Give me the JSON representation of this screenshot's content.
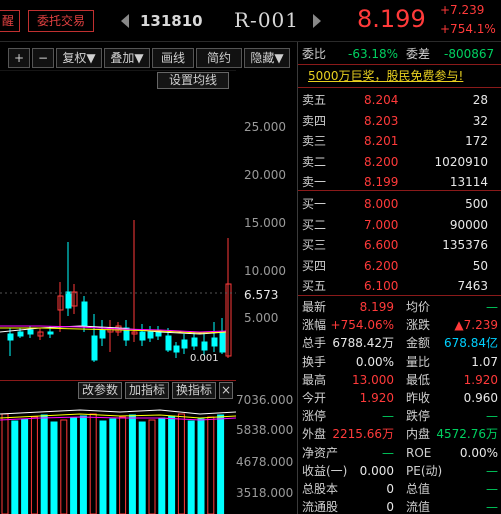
{
  "topbar": {
    "partial_tab": "醒",
    "trade_button": "委托交易",
    "code": "131810",
    "name": "R-001",
    "price": "8.199",
    "change": "+7.239",
    "change_pct": "+754.1%"
  },
  "toolbar": {
    "plus": "+",
    "minus": "−",
    "restore_rights": "复权▼",
    "overlay": "叠加▼",
    "draw_line": "画线",
    "brief": "简约",
    "hide": "隐藏▼"
  },
  "chart": {
    "ma_settings": "设置均线",
    "y_ticks": [
      "25.000",
      "20.000",
      "15.000",
      "10.000",
      "6.573",
      "5.000"
    ],
    "low_marker": "0.001",
    "indicator_buttons": {
      "change_params": "改参数",
      "add_indicator": "加指标",
      "switch_indicator": "换指标",
      "close": "×"
    },
    "vol_ticks": [
      "7036.000",
      "5838.000",
      "4678.000",
      "3518.000"
    ],
    "colors": {
      "up": "#ff3a3a",
      "down": "#00ffff",
      "ma5": "#ffffff",
      "ma10": "#ffff00",
      "ma20": "#ff00ff"
    }
  },
  "panel": {
    "weibi_label": "委比",
    "weibi": "-63.18%",
    "weicha_label": "委差",
    "weicha": "-800867",
    "ad": "5000万巨奖，股民免费参与!",
    "asks": [
      {
        "label": "卖五",
        "price": "8.204",
        "vol": "28"
      },
      {
        "label": "卖四",
        "price": "8.203",
        "vol": "32"
      },
      {
        "label": "卖三",
        "price": "8.201",
        "vol": "172"
      },
      {
        "label": "卖二",
        "price": "8.200",
        "vol": "1020910"
      },
      {
        "label": "卖一",
        "price": "8.199",
        "vol": "13114"
      }
    ],
    "bids": [
      {
        "label": "买一",
        "price": "8.000",
        "vol": "500"
      },
      {
        "label": "买二",
        "price": "7.000",
        "vol": "90000"
      },
      {
        "label": "买三",
        "price": "6.600",
        "vol": "135376"
      },
      {
        "label": "买四",
        "price": "6.200",
        "vol": "50"
      },
      {
        "label": "买五",
        "price": "6.100",
        "vol": "7463"
      }
    ],
    "stats": [
      {
        "l1": "最新",
        "v1": "8.199",
        "c1": "red",
        "l2": "均价",
        "v2": "—",
        "c2": "green"
      },
      {
        "l1": "涨幅",
        "v1": "+754.06%",
        "c1": "red",
        "l2": "涨跌",
        "v2": "▲7.239",
        "c2": "red"
      },
      {
        "l1": "总手",
        "v1": "6788.42万",
        "c1": "white",
        "l2": "金额",
        "v2": "678.84亿",
        "c2": "cyan"
      },
      {
        "l1": "换手",
        "v1": "0.00%",
        "c1": "white",
        "l2": "量比",
        "v2": "1.07",
        "c2": "white"
      },
      {
        "l1": "最高",
        "v1": "13.000",
        "c1": "red",
        "l2": "最低",
        "v2": "1.920",
        "c2": "red"
      },
      {
        "l1": "今开",
        "v1": "1.920",
        "c1": "red",
        "l2": "昨收",
        "v2": "0.960",
        "c2": "white"
      },
      {
        "l1": "涨停",
        "v1": "—",
        "c1": "green",
        "l2": "跌停",
        "v2": "—",
        "c2": "green"
      },
      {
        "l1": "外盘",
        "v1": "2215.66万",
        "c1": "red",
        "l2": "内盘",
        "v2": "4572.76万",
        "c2": "green"
      },
      {
        "l1": "净资产",
        "v1": "—",
        "c1": "green",
        "l2": "ROE",
        "v2": "0.00%",
        "c2": "white"
      },
      {
        "l1": "收益(一)",
        "v1": "0.000",
        "c1": "white",
        "l2": "PE(动)",
        "v2": "—",
        "c2": "green"
      },
      {
        "l1": "总股本",
        "v1": "0",
        "c1": "white",
        "l2": "总值",
        "v2": "—",
        "c2": "green"
      },
      {
        "l1": "流通股",
        "v1": "0",
        "c1": "white",
        "l2": "流值",
        "v2": "—",
        "c2": "green"
      }
    ]
  }
}
